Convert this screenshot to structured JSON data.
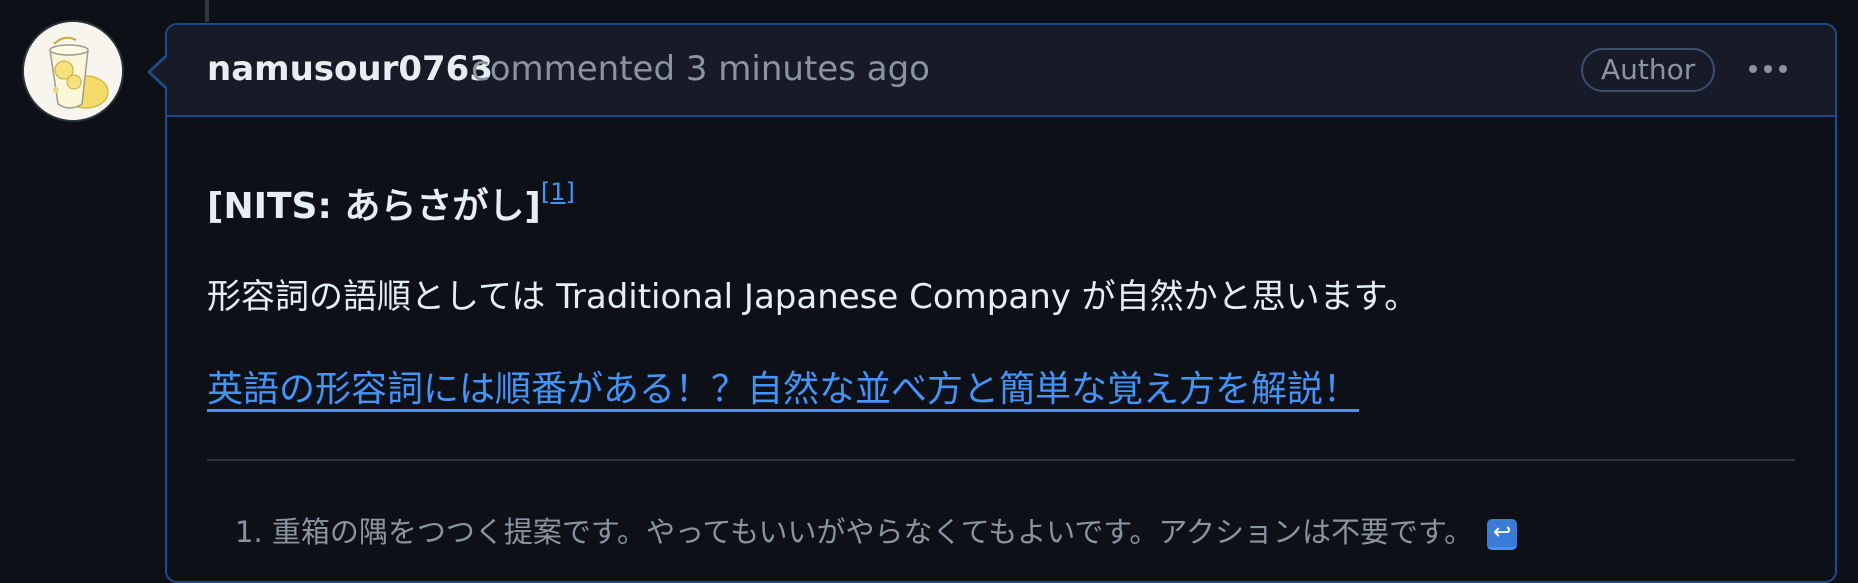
{
  "comment": {
    "author": "namusour0763",
    "action": "commented",
    "time": "3 minutes ago",
    "badge": "Author",
    "menu_icon": "kebab-horizontal-icon",
    "avatar_icon": "lemon-sour-avatar"
  },
  "body": {
    "nits_label": "[NITS: あらさがし]",
    "nits_ref": "[1]",
    "sentence": "形容詞の語順としては Traditional Japanese Company が自然かと思います。",
    "link_text": "英語の形容詞には順番がある！？自然な並べ方と簡単な覚え方を解説！",
    "footnote_number": "1.",
    "footnote_text": "重箱の隅をつつく提案です。やってもいいがやらなくてもよいです。アクションは不要です。",
    "backref_icon": "↩"
  },
  "colors": {
    "background": "#0d1117",
    "header_bg": "#161b27",
    "border_accent": "#1f4a8a",
    "link": "#4493f8",
    "muted": "#8b949e"
  }
}
